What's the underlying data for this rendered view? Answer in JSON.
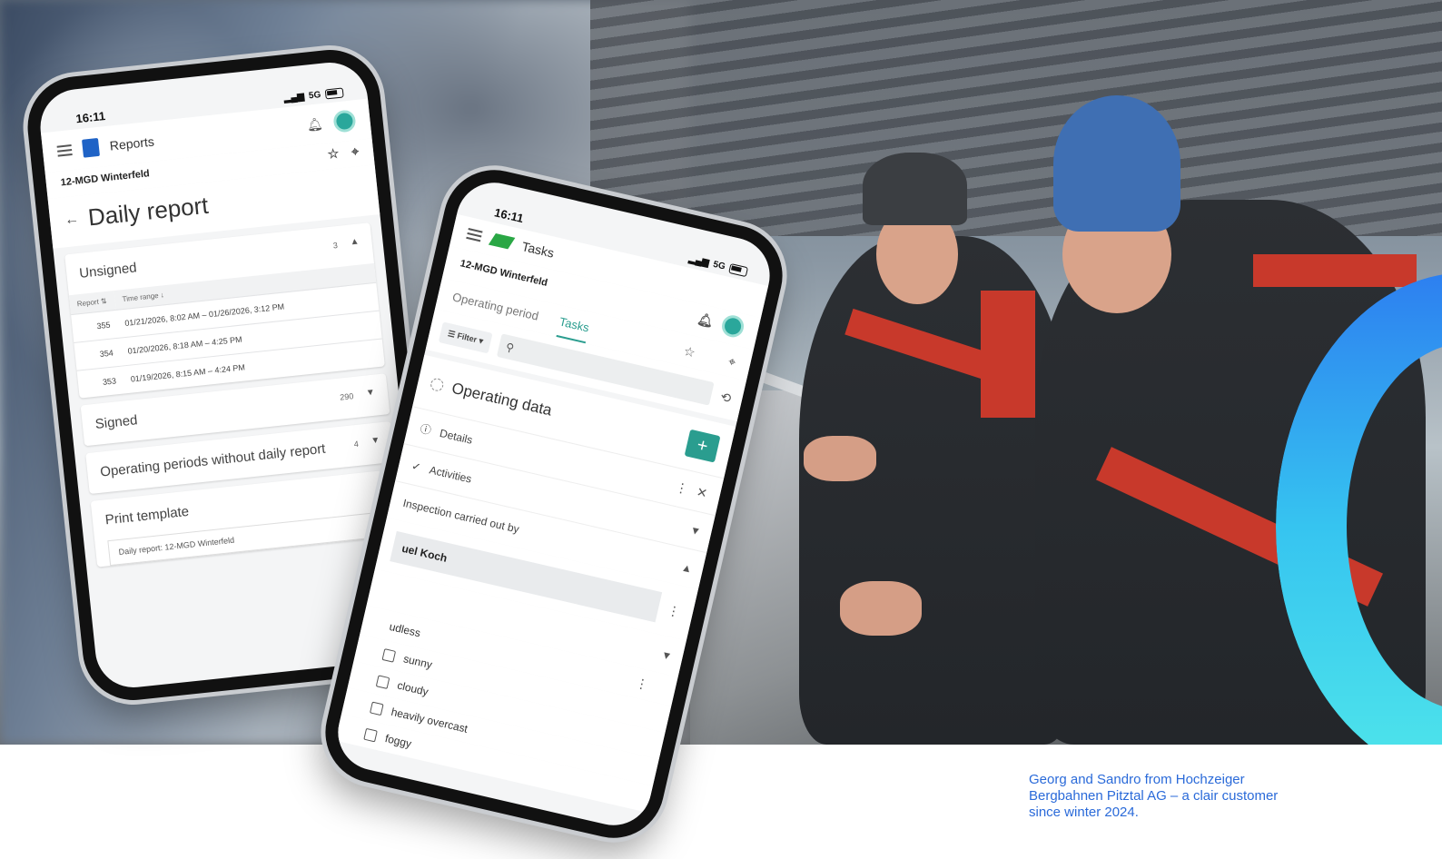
{
  "caption": "Georg and Sandro from Hochzeiger Bergbahnen Pitztal AG – a clair customer since winter 2024.",
  "phone_left": {
    "time": "16:11",
    "network": "5G",
    "app_title": "Reports",
    "location": "12-MGD Winterfeld",
    "page_title": "Daily report",
    "unsigned": {
      "label": "Unsigned",
      "count": "3",
      "columns": [
        "Report",
        "Time range"
      ],
      "rows": [
        {
          "report": "355",
          "range": "01/21/2026, 8:02 AM – 01/26/2026, 3:12 PM"
        },
        {
          "report": "354",
          "range": "01/20/2026, 8:18 AM – 4:25 PM"
        },
        {
          "report": "353",
          "range": "01/19/2026, 8:15 AM – 4:24 PM"
        }
      ]
    },
    "signed": {
      "label": "Signed",
      "count": "290"
    },
    "without_report": {
      "label": "Operating periods without daily report",
      "count": "4"
    },
    "print_template": {
      "label": "Print template",
      "value": "Daily report: 12-MGD Winterfeld"
    }
  },
  "phone_right": {
    "time": "16:11",
    "network": "5G",
    "app_title": "Tasks",
    "location": "12-MGD Winterfeld",
    "tabs": [
      "Operating period",
      "Tasks"
    ],
    "filter_label": "Filter",
    "section_title": "Operating data",
    "details_label": "Details",
    "activities_label": "Activities",
    "inspection_label": "Inspection carried out by",
    "inspector": "uel Koch",
    "weather_options": [
      "udless",
      "sunny",
      "cloudy",
      "heavily overcast",
      "foggy"
    ]
  },
  "colors": {
    "caption": "#2a6ad9",
    "accent": "#2a9d8f",
    "ring_start": "#2d7ff0",
    "ring_end": "#4fe6ea"
  }
}
